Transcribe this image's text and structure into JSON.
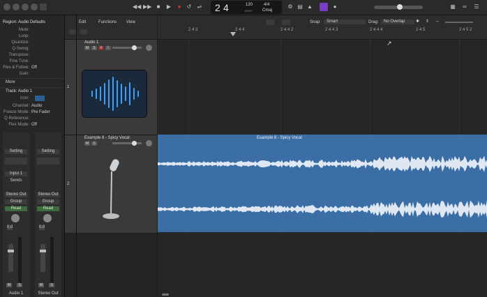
{
  "control_bar": {
    "position_bar": "2",
    "position_beat": "4",
    "tempo": "120",
    "tempo_sub": "KEEP",
    "signature": "4/4",
    "key": "Cmaj",
    "icons": [
      "library-icon",
      "inspector-icon",
      "smart-controls-icon",
      "mixer-icon",
      "editors-icon",
      "rewind-icon",
      "fast-forward-icon",
      "stop-icon",
      "play-icon",
      "record-icon",
      "cycle-icon",
      "tuner-icon",
      "count-in-icon",
      "metronome-icon",
      "notes-icon",
      "loops-icon",
      "browser-icon"
    ]
  },
  "inspector": {
    "region_header": "Region: Audio Defaults",
    "region_rows": [
      {
        "label": "Mute:",
        "value": ""
      },
      {
        "label": "Loop:",
        "value": ""
      },
      {
        "label": "Quantize:",
        "value": ""
      },
      {
        "label": "Q-Swing:",
        "value": ""
      },
      {
        "label": "Transpose:",
        "value": ""
      },
      {
        "label": "Fine Tune:",
        "value": ""
      },
      {
        "label": "Flex & Follow:",
        "value": "Off"
      },
      {
        "label": "Gain:",
        "value": ""
      }
    ],
    "more_label": "More",
    "track_header": "Track: Audio 1",
    "track_rows": [
      {
        "label": "Icon:",
        "value": ""
      },
      {
        "label": "Channel:",
        "value": "Audio"
      },
      {
        "label": "Freeze Mode:",
        "value": "Pre Fader"
      },
      {
        "label": "Q-Reference:",
        "value": ""
      },
      {
        "label": "Flex Mode:",
        "value": "Off"
      }
    ],
    "channel_strips": [
      {
        "setting": "Setting",
        "eq": "EQ",
        "input": "Input 1",
        "sends": "Sends",
        "stereo": "Stereo Out",
        "group": "Group",
        "read": "Read",
        "pan": "0.0",
        "mute": "M",
        "solo": "S",
        "name": "Audio 1"
      },
      {
        "setting": "Setting",
        "eq": "",
        "input": "",
        "sends": "",
        "stereo": "Stereo Out",
        "group": "Group",
        "read": "Read",
        "pan": "0.0",
        "mute": "M",
        "solo": "S",
        "name": "Stereo Out"
      }
    ]
  },
  "tracks_toolbar": {
    "edit_label": "Edit",
    "functions_label": "Functions",
    "view_label": "View",
    "snap_label": "Snap:",
    "snap_value": "Smart",
    "drag_label": "Drag:",
    "drag_value": "No Overlap"
  },
  "ruler": {
    "marks": [
      "2 4 3",
      "2 4 4",
      "2 4 4 2",
      "2 4 4 3",
      "2 4 4 4",
      "2 4 5",
      "2 4 5 2",
      "2 4 5 3",
      "2 4 5 4"
    ]
  },
  "tracks": [
    {
      "number": "1",
      "name": "Audio 1",
      "mute": "M",
      "solo": "S",
      "record": "R",
      "input": "I",
      "icon": "audio-waveform-icon"
    },
    {
      "number": "2",
      "name": "Example 8 - Spicy Vocal",
      "mute": "M",
      "solo": "S",
      "icon": "microphone-icon"
    }
  ],
  "region": {
    "name": "Example 8 - Spicy Vocal",
    "color": "#3a6ea5"
  },
  "colors": {
    "region": "#3a6ea5",
    "waveform": "#dfe8f2",
    "record": "#e0322e",
    "icon_blue": "#3aa0ff"
  }
}
